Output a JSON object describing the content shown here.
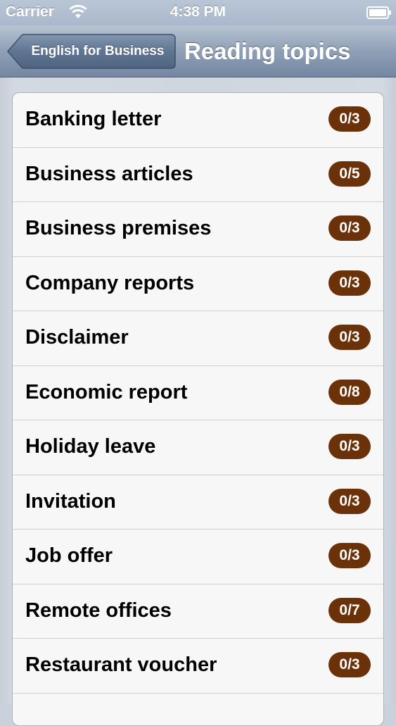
{
  "status_bar": {
    "carrier": "Carrier",
    "time": "4:38 PM",
    "wifi_icon": "wifi-icon",
    "battery_icon": "battery-icon"
  },
  "nav_bar": {
    "back_label": "English for Business",
    "title": "Reading topics"
  },
  "colors": {
    "badge_background": "#6b3108",
    "badge_text": "#ffffff",
    "nav_bar": "#8fa0b6"
  },
  "topics": [
    {
      "title": "Banking letter",
      "progress": "0/3"
    },
    {
      "title": "Business articles",
      "progress": "0/5"
    },
    {
      "title": "Business premises",
      "progress": "0/3"
    },
    {
      "title": "Company reports",
      "progress": "0/3"
    },
    {
      "title": "Disclaimer",
      "progress": "0/3"
    },
    {
      "title": "Economic report",
      "progress": "0/8"
    },
    {
      "title": "Holiday leave",
      "progress": "0/3"
    },
    {
      "title": "Invitation",
      "progress": "0/3"
    },
    {
      "title": "Job offer",
      "progress": "0/3"
    },
    {
      "title": "Remote offices",
      "progress": "0/7"
    },
    {
      "title": "Restaurant voucher",
      "progress": "0/3"
    }
  ]
}
